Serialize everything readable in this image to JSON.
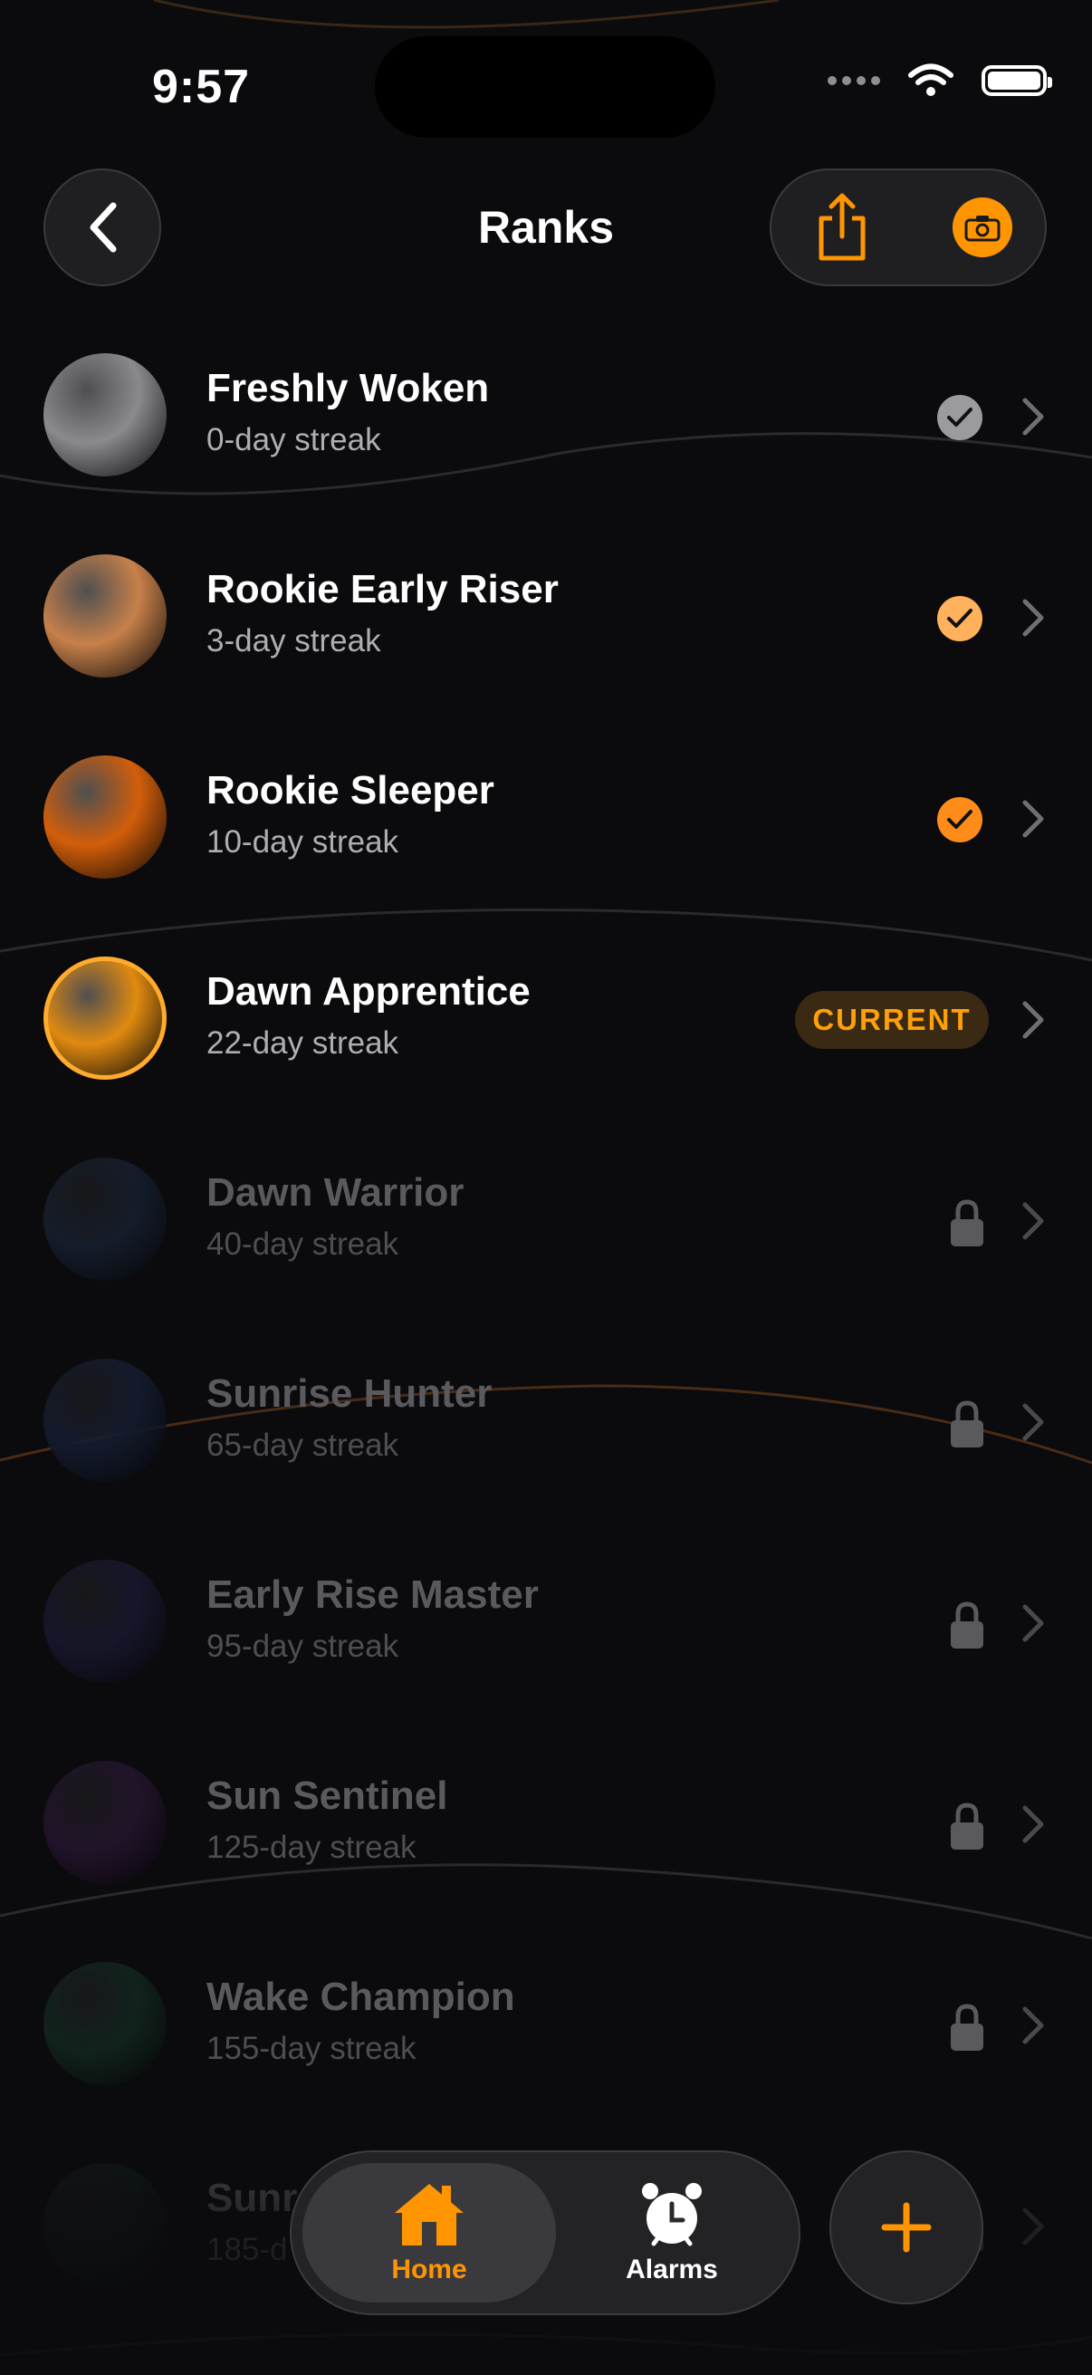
{
  "status_bar": {
    "time": "9:57"
  },
  "header": {
    "title": "Ranks"
  },
  "colors": {
    "accent": "#ff9500",
    "background": "#0b0b0d",
    "locked_text": "#5a5a5e"
  },
  "ranks": [
    {
      "name": "Freshly Woken",
      "subtitle": "0-day streak",
      "state": "achieved",
      "orb_color": "#8a8a8e",
      "check_color": "#9b9b9f"
    },
    {
      "name": "Rookie Early Riser",
      "subtitle": "3-day streak",
      "state": "achieved",
      "orb_color": "#c7804a",
      "check_color": "#ffb15c"
    },
    {
      "name": "Rookie Sleeper",
      "subtitle": "10-day streak",
      "state": "achieved",
      "orb_color": "#d25e0a",
      "check_color": "#ff8c1a"
    },
    {
      "name": "Dawn Apprentice",
      "subtitle": "22-day streak",
      "state": "current",
      "badge": "CURRENT",
      "orb_color": "#e08a10"
    },
    {
      "name": "Dawn Warrior",
      "subtitle": "40-day streak",
      "state": "locked",
      "orb_color": "#151c2b"
    },
    {
      "name": "Sunrise Hunter",
      "subtitle": "65-day streak",
      "state": "locked",
      "orb_color": "#141a2c"
    },
    {
      "name": "Early Rise Master",
      "subtitle": "95-day streak",
      "state": "locked",
      "orb_color": "#17162a"
    },
    {
      "name": "Sun Sentinel",
      "subtitle": "125-day streak",
      "state": "locked",
      "orb_color": "#21132a"
    },
    {
      "name": "Wake Champion",
      "subtitle": "155-day streak",
      "state": "locked",
      "orb_color": "#11221d"
    },
    {
      "name": "Sunr",
      "subtitle": "185-d",
      "state": "locked",
      "orb_color": "#10191b"
    }
  ],
  "tab_bar": {
    "home_label": "Home",
    "alarms_label": "Alarms",
    "home_icon": "house-icon",
    "alarms_icon": "alarm-clock-icon",
    "add_icon": "plus-icon"
  }
}
